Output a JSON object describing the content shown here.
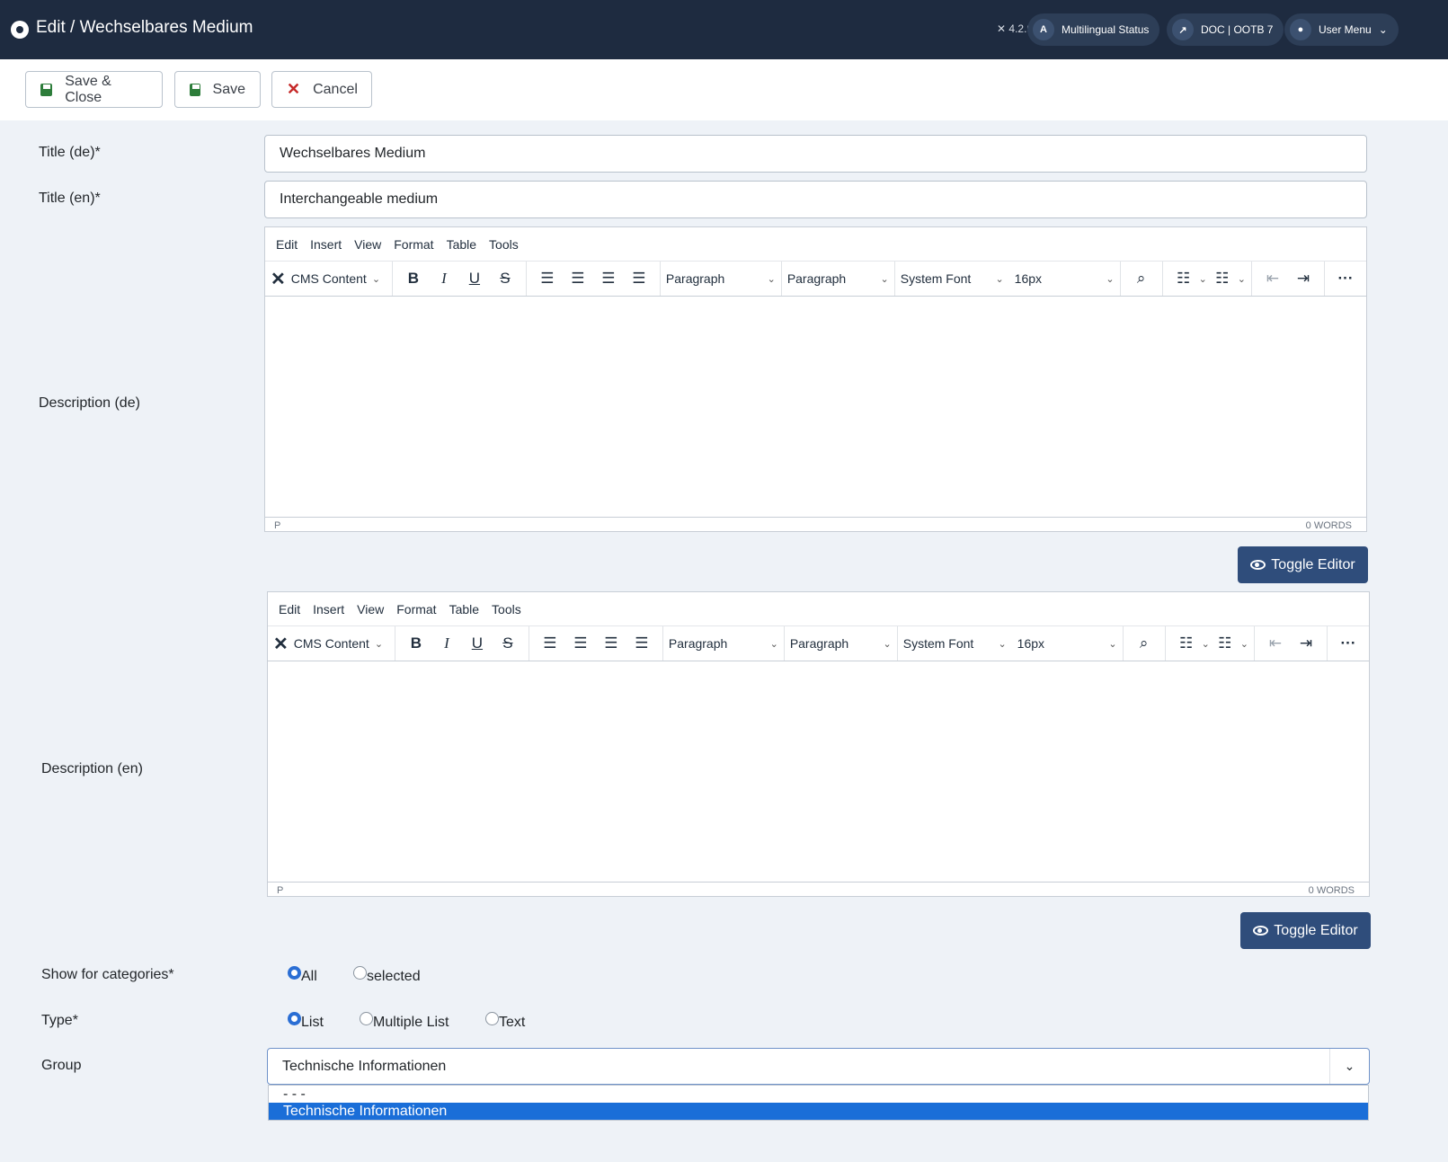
{
  "header": {
    "title": "Edit / Wechselbares Medium",
    "version": "4.2.9",
    "multilingual_label": "Multilingual Status",
    "doc_label": "DOC | OOTB 7",
    "user_menu_label": "User Menu"
  },
  "toolbar": {
    "save_close_label": "Save & Close",
    "save_label": "Save",
    "cancel_label": "Cancel"
  },
  "form": {
    "title_de_label": "Title (de)*",
    "title_de_value": "Wechselbares Medium",
    "title_en_label": "Title (en)*",
    "title_en_value": "Interchangeable medium",
    "desc_de_label": "Description (de)",
    "desc_en_label": "Description (en)",
    "categories_label": "Show for categories*",
    "categories_options": [
      "All",
      "selected"
    ],
    "type_label": "Type*",
    "type_options": [
      "List",
      "Multiple List",
      "Text"
    ],
    "group_label": "Group",
    "group_value": "Technische Informationen",
    "group_options": [
      "- - -",
      "Technische Informationen"
    ]
  },
  "editor": {
    "menu": [
      "Edit",
      "Insert",
      "View",
      "Format",
      "Table",
      "Tools"
    ],
    "cms_content": "CMS Content",
    "block_format": "Paragraph",
    "style_format": "Paragraph",
    "font_family": "System Font",
    "font_size": "16px",
    "path": "P",
    "word_count": "0 WORDS",
    "toggle_label": "Toggle Editor"
  },
  "colors": {
    "header_bg": "#1e2b40",
    "toggle_bg": "#2f4d7b",
    "selected_option_bg": "#1a6ed8"
  }
}
